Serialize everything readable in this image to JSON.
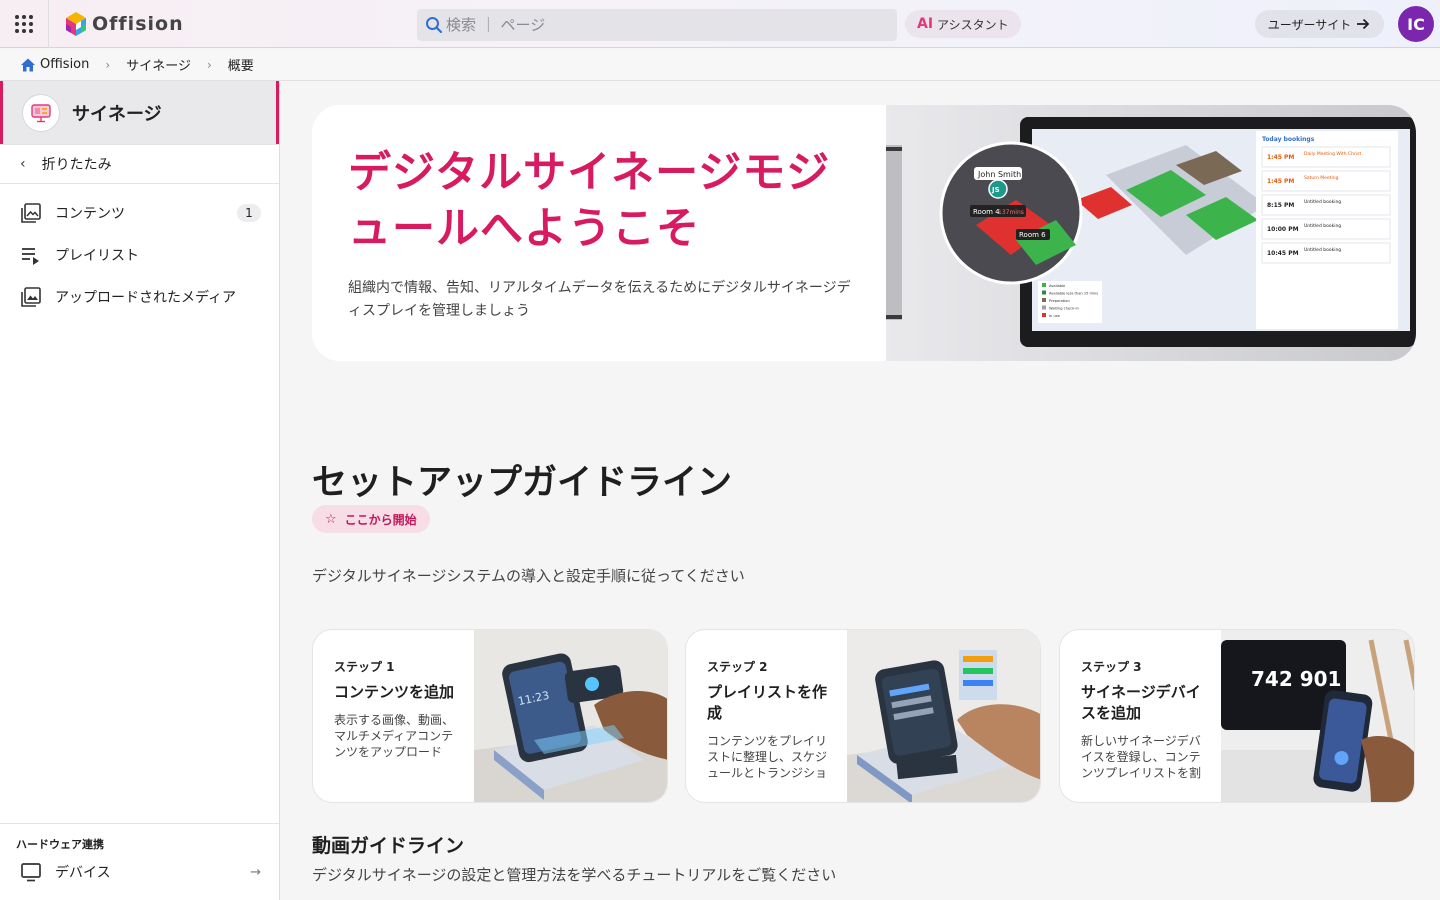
{
  "topbar": {
    "logo_text": "Offision",
    "search_placeholder": "検索 ｜ ページ",
    "ai_mark": "AI",
    "ai_label": "アシスタント",
    "user_site_label": "ユーザーサイト",
    "avatar_initials": "IC",
    "avatar_color": "#7b27ad"
  },
  "breadcrumb": [
    "Offision",
    "サイネージ",
    "概要"
  ],
  "sidebar": {
    "module_title": "サイネージ",
    "collapse_label": "折りたたみ",
    "items": [
      {
        "label": "コンテンツ",
        "icon": "photo-library-icon",
        "badge": "1"
      },
      {
        "label": "プレイリスト",
        "icon": "playlist-icon"
      },
      {
        "label": "アップロードされたメディア",
        "icon": "uploaded-media-icon"
      }
    ],
    "hardware_label": "ハードウェア連携",
    "hardware_items": [
      {
        "label": "デバイス",
        "icon": "monitor-icon"
      }
    ]
  },
  "hero": {
    "title": "デジタルサイネージモジュールへようこそ",
    "description": "組織内で情報、告知、リアルタイムデータを伝えるためにデジタルサイネージディスプレイを管理しましょう",
    "art": {
      "panel_title": "Today bookings",
      "user_name": "John Smith",
      "user_initials": "JS",
      "room_a": "Room 4",
      "room_a_time": "137mins",
      "room_b": "Room 6",
      "bookings": [
        {
          "time": "1:45 PM",
          "title": "Daily Meeting With Christ"
        },
        {
          "time": "1:45 PM",
          "title": "Saturn Meeting"
        },
        {
          "time": "8:15 PM",
          "title": "Untitled booking"
        },
        {
          "time": "10:00 PM",
          "title": "Untitled booking"
        },
        {
          "time": "10:45 PM",
          "title": "Untitled booking"
        }
      ],
      "legend": [
        "Available",
        "Available less than 15 mins",
        "Preparation",
        "Waiting check-in",
        "In use"
      ]
    }
  },
  "setup": {
    "title": "セットアップガイドライン",
    "chip": "ここから開始",
    "description": "デジタルサイネージシステムの導入と設定手順に従ってください",
    "steps": [
      {
        "step": "ステップ 1",
        "title": "コンテンツを追加",
        "description": "表示する画像、動画、マルチメディアコンテンツをアップロード",
        "screen_text": "11:23"
      },
      {
        "step": "ステップ 2",
        "title": "プレイリストを作成",
        "description": "コンテンツをプレイリストに整理し、スケジュールとトランジションを設定"
      },
      {
        "step": "ステップ 3",
        "title": "サイネージデバイスを追加",
        "description": "新しいサイネージデバイスを登録し、コンテンツプレイリストを割り当て",
        "screen_text": "742 901"
      }
    ]
  },
  "video": {
    "title": "動画ガイドライン",
    "description": "デジタルサイネージの設定と管理方法を学べるチュートリアルをご覧ください"
  },
  "colors": {
    "accent": "#d81b60",
    "chip_bg": "#f6dde6"
  }
}
